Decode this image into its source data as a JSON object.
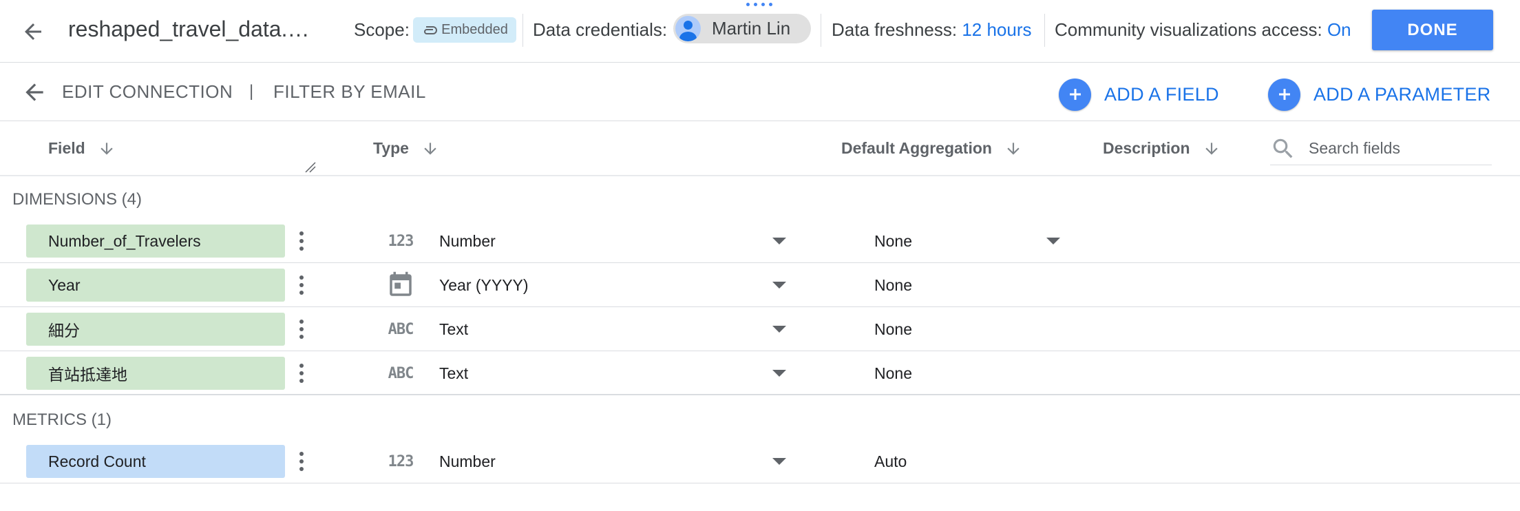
{
  "topbar": {
    "file_name": "reshaped_travel_data.c...",
    "scope_label": "Scope:",
    "scope_value": "Embedded",
    "credentials_label": "Data credentials:",
    "credentials_user": "Martin Lin",
    "freshness_label": "Data freshness:",
    "freshness_value": "12 hours",
    "community_label": "Community visualizations access:",
    "community_value": "On",
    "done_label": "DONE"
  },
  "subbar": {
    "edit_connection": "EDIT CONNECTION",
    "separator": "|",
    "filter_by_email": "FILTER BY EMAIL",
    "add_field": "ADD A FIELD",
    "add_parameter": "ADD A PARAMETER"
  },
  "columns": {
    "field": "Field",
    "type": "Type",
    "default_aggregation": "Default Aggregation",
    "description": "Description",
    "search_placeholder": "Search fields"
  },
  "dimensions": {
    "title": "DIMENSIONS (4)",
    "rows": [
      {
        "name": "Number_of_Travelers",
        "type_icon": "123",
        "type": "Number",
        "aggregation": "None",
        "aggregation_editable": true
      },
      {
        "name": "Year",
        "type_icon": "calendar-icon",
        "type": "Year (YYYY)",
        "aggregation": "None",
        "aggregation_editable": false
      },
      {
        "name": "細分",
        "type_icon": "ABC",
        "type": "Text",
        "aggregation": "None",
        "aggregation_editable": false
      },
      {
        "name": "首站抵達地",
        "type_icon": "ABC",
        "type": "Text",
        "aggregation": "None",
        "aggregation_editable": false
      }
    ]
  },
  "metrics": {
    "title": "METRICS (1)",
    "rows": [
      {
        "name": "Record Count",
        "type_icon": "123",
        "type": "Number",
        "aggregation": "Auto",
        "aggregation_editable": false
      }
    ]
  },
  "colors": {
    "accent": "#1a73e8",
    "primary_button": "#4285f4",
    "dimension_pill": "#cfe7ce",
    "metric_pill": "#c2dcf8",
    "scope_chip": "#d2ecf9"
  }
}
